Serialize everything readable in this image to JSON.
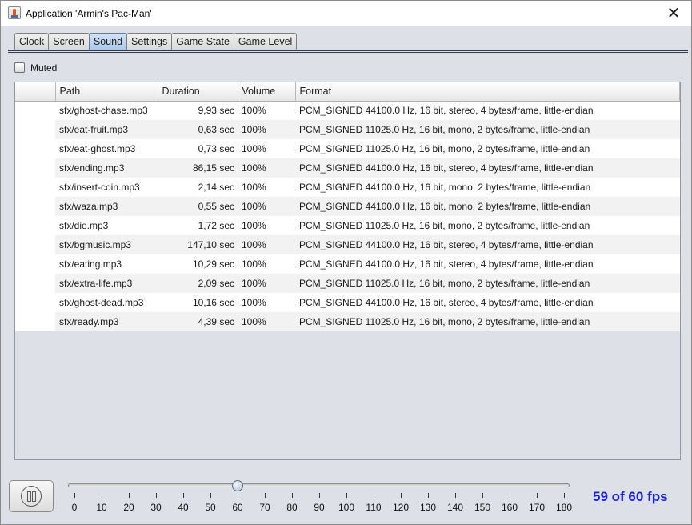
{
  "window": {
    "title": "Application 'Armin's Pac-Man'",
    "close_label": "✕"
  },
  "tabs": [
    {
      "label": "Clock"
    },
    {
      "label": "Screen"
    },
    {
      "label": "Sound",
      "active": true
    },
    {
      "label": "Settings"
    },
    {
      "label": "Game State"
    },
    {
      "label": "Game Level"
    }
  ],
  "muted": {
    "label": "Muted",
    "checked": false
  },
  "table": {
    "columns": [
      "",
      "Path",
      "Duration",
      "Volume",
      "Format"
    ],
    "rows": [
      {
        "index": "",
        "path": "sfx/ghost-chase.mp3",
        "duration": "9,93 sec",
        "volume": "100%",
        "format": "PCM_SIGNED 44100.0 Hz, 16 bit, stereo, 4 bytes/frame, little-endian"
      },
      {
        "index": "",
        "path": "sfx/eat-fruit.mp3",
        "duration": "0,63 sec",
        "volume": "100%",
        "format": "PCM_SIGNED 11025.0 Hz, 16 bit, mono, 2 bytes/frame, little-endian"
      },
      {
        "index": "",
        "path": "sfx/eat-ghost.mp3",
        "duration": "0,73 sec",
        "volume": "100%",
        "format": "PCM_SIGNED 11025.0 Hz, 16 bit, mono, 2 bytes/frame, little-endian"
      },
      {
        "index": "",
        "path": "sfx/ending.mp3",
        "duration": "86,15 sec",
        "volume": "100%",
        "format": "PCM_SIGNED 44100.0 Hz, 16 bit, stereo, 4 bytes/frame, little-endian"
      },
      {
        "index": "",
        "path": "sfx/insert-coin.mp3",
        "duration": "2,14 sec",
        "volume": "100%",
        "format": "PCM_SIGNED 44100.0 Hz, 16 bit, mono, 2 bytes/frame, little-endian"
      },
      {
        "index": "",
        "path": "sfx/waza.mp3",
        "duration": "0,55 sec",
        "volume": "100%",
        "format": "PCM_SIGNED 44100.0 Hz, 16 bit, mono, 2 bytes/frame, little-endian"
      },
      {
        "index": "",
        "path": "sfx/die.mp3",
        "duration": "1,72 sec",
        "volume": "100%",
        "format": "PCM_SIGNED 11025.0 Hz, 16 bit, mono, 2 bytes/frame, little-endian"
      },
      {
        "index": "",
        "path": "sfx/bgmusic.mp3",
        "duration": "147,10 sec",
        "volume": "100%",
        "format": "PCM_SIGNED 44100.0 Hz, 16 bit, stereo, 4 bytes/frame, little-endian"
      },
      {
        "index": "",
        "path": "sfx/eating.mp3",
        "duration": "10,29 sec",
        "volume": "100%",
        "format": "PCM_SIGNED 44100.0 Hz, 16 bit, stereo, 4 bytes/frame, little-endian"
      },
      {
        "index": "",
        "path": "sfx/extra-life.mp3",
        "duration": "2,09 sec",
        "volume": "100%",
        "format": "PCM_SIGNED 11025.0 Hz, 16 bit, mono, 2 bytes/frame, little-endian"
      },
      {
        "index": "",
        "path": "sfx/ghost-dead.mp3",
        "duration": "10,16 sec",
        "volume": "100%",
        "format": "PCM_SIGNED 44100.0 Hz, 16 bit, stereo, 4 bytes/frame, little-endian"
      },
      {
        "index": "",
        "path": "sfx/ready.mp3",
        "duration": "4,39 sec",
        "volume": "100%",
        "format": "PCM_SIGNED 11025.0 Hz, 16 bit, mono, 2 bytes/frame, little-endian"
      }
    ]
  },
  "controls": {
    "pause_icon": "pause-icon",
    "fps_slider": {
      "min": 0,
      "max": 180,
      "value": 60,
      "ticks": [
        "0",
        "10",
        "20",
        "30",
        "40",
        "50",
        "60",
        "70",
        "80",
        "90",
        "100",
        "110",
        "120",
        "130",
        "140",
        "150",
        "160",
        "170",
        "180"
      ]
    },
    "fps_readout": "59 of 60 fps",
    "fps_color": "#1e22d6"
  },
  "colors": {
    "tab_active": "#aac8e8",
    "window_bg": "#dde1e7"
  }
}
